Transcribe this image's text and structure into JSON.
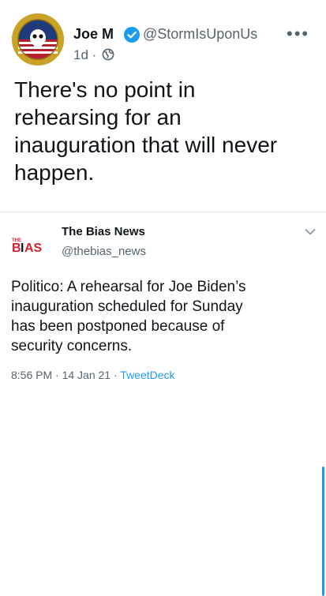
{
  "tweet": {
    "author_name": "Joe M",
    "handle": "@StormIsUponUs",
    "age": "1d",
    "separator": "·",
    "text": "There's no point in\nrehearsing for an\ninauguration that will never\nhappen.",
    "icons": {
      "verified": "verified-badge-icon",
      "visibility": "globe-icon",
      "menu": "more-icon"
    }
  },
  "quoted": {
    "author_name": "The Bias News",
    "handle": "@thebias_news",
    "logo_text": "THE BIAS",
    "text": "Politico: A rehearsal for Joe Biden’s\ninauguration scheduled for Sunday\nhas been postponed because of\nsecurity concerns.",
    "time": "8:56 PM",
    "date": "14 Jan 21",
    "source": "TweetDeck",
    "separator": "·"
  },
  "colors": {
    "text": "#0f1419",
    "secondary": "#536471",
    "accent": "#1d9bf0",
    "bias_red": "#d4202a"
  }
}
